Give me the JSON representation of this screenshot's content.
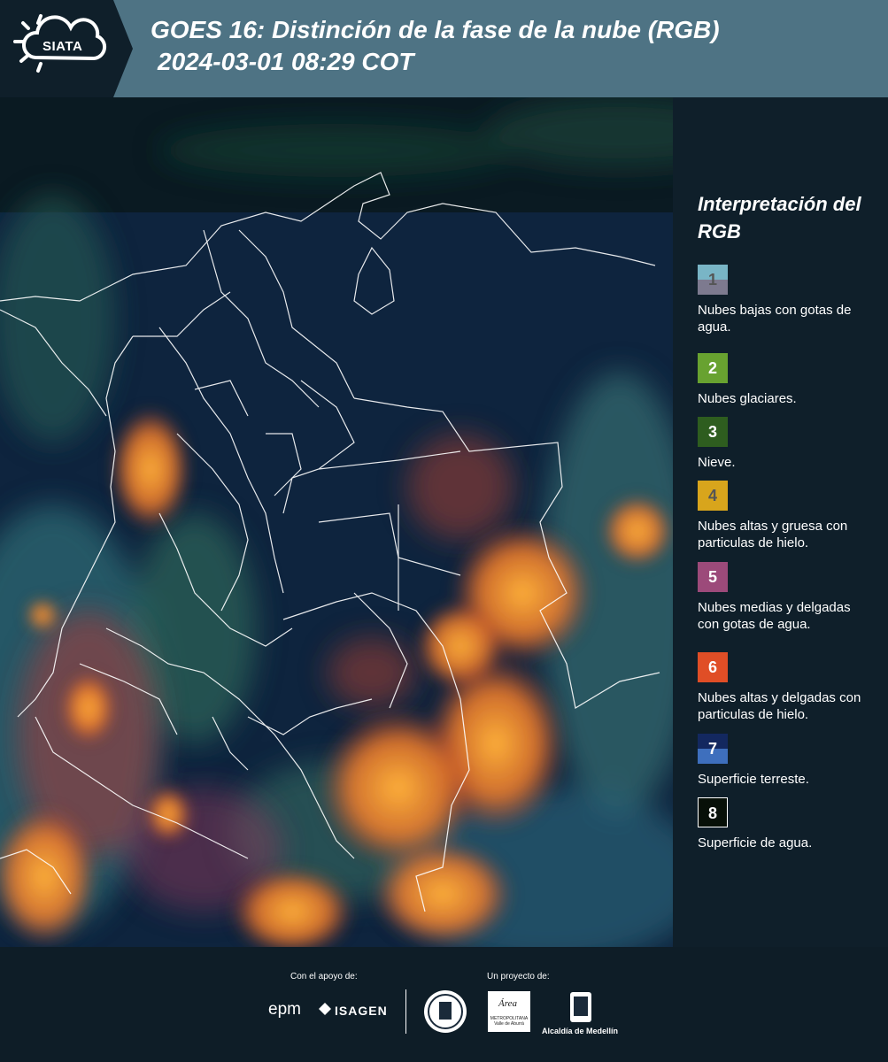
{
  "header": {
    "logo_text": "SIATA",
    "title_line1": "GOES 16: Distinción de la fase de la nube (RGB)",
    "title_line2": "2024-03-01 08:29 COT",
    "background": "#4e7384"
  },
  "legend": {
    "title": "Interpretación del RGB",
    "items": [
      {
        "number": "1",
        "label": "Nubes bajas con gotas de agua.",
        "color_top": "#79b5c6",
        "color_bottom": "#7d7a8f",
        "text_color": "#555555"
      },
      {
        "number": "2",
        "label": "Nubes glaciares.",
        "color": "#68a230",
        "text_color": "#ffffff"
      },
      {
        "number": "3",
        "label": "Nieve.",
        "color": "#2e5d1f",
        "text_color": "#ffffff"
      },
      {
        "number": "4",
        "label": "Nubes altas y gruesa con particulas de hielo.",
        "color": "#d8a51c",
        "text_color": "#555555"
      },
      {
        "number": "5",
        "label": "Nubes medias y delgadas con gotas de agua.",
        "color": "#9c4a7a",
        "text_color": "#ffffff"
      },
      {
        "number": "6",
        "label": "Nubes altas y delgadas con particulas de hielo.",
        "color": "#e04e26",
        "text_color": "#ffffff"
      },
      {
        "number": "7",
        "label": "Superficie terreste.",
        "color_top": "#13285f",
        "color_bottom": "#3e6fbd",
        "text_color": "#ffffff"
      },
      {
        "number": "8",
        "label": "Superficie de agua.",
        "color": "#071008",
        "text_color": "#ffffff"
      }
    ]
  },
  "footer": {
    "support_label": "Con el apoyo de:",
    "project_label": "Un proyecto de:",
    "sponsor_1": "epm",
    "sponsor_2": "ISAGEN",
    "partner_area": "Área",
    "partner_area_sub": "METROPOLITANA Valle de Aburrá",
    "partner_alcaldia": "Alcaldía de Medellín"
  }
}
